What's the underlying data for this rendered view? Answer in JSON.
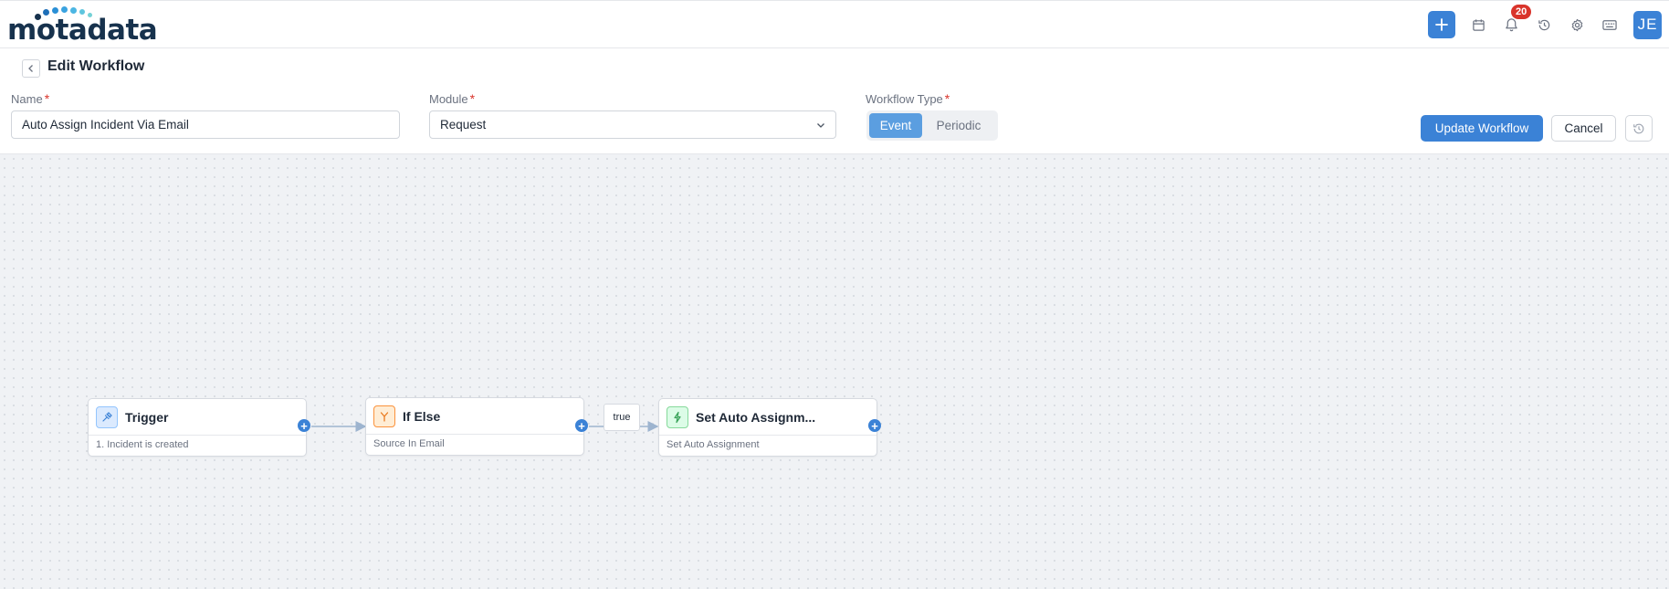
{
  "app": {
    "logo_text": "motadata",
    "notification_count": "20",
    "avatar_initials": "JE"
  },
  "header": {
    "title": "Edit Workflow"
  },
  "form": {
    "name_label": "Name",
    "name_value": "Auto Assign Incident Via Email",
    "module_label": "Module",
    "module_value": "Request",
    "workflow_type_label": "Workflow Type",
    "workflow_type_options": [
      "Event",
      "Periodic"
    ],
    "workflow_type_selected": "Event",
    "required_mark": "*"
  },
  "actions": {
    "update_label": "Update Workflow",
    "cancel_label": "Cancel"
  },
  "workflow": {
    "nodes": [
      {
        "title": "Trigger",
        "subtitle": "1. Incident is created",
        "icon": "trigger-icon"
      },
      {
        "title": "If Else",
        "subtitle": "Source In Email",
        "icon": "branch-icon"
      },
      {
        "title": "Set Auto Assignm...",
        "subtitle": "Set Auto Assignment",
        "icon": "action-icon"
      }
    ],
    "edge_label": "true",
    "port_symbol": "+"
  },
  "icons": {
    "add": "plus-icon",
    "calendar": "calendar-icon",
    "notifications": "bell-icon",
    "history": "history-icon",
    "settings": "gear-icon",
    "keyboard": "keyboard-icon",
    "back": "chevron-left-icon",
    "select": "chevron-down-icon",
    "revert": "revert-icon"
  },
  "colors": {
    "primary": "#3b82d6",
    "segment_active": "#5b9ee0",
    "required": "#d9342b",
    "badge": "#d9342b",
    "trigger_icon_bg": "#dbeafe",
    "branch_icon_bg": "#ffedd5",
    "action_icon_bg": "#dcfce7"
  }
}
